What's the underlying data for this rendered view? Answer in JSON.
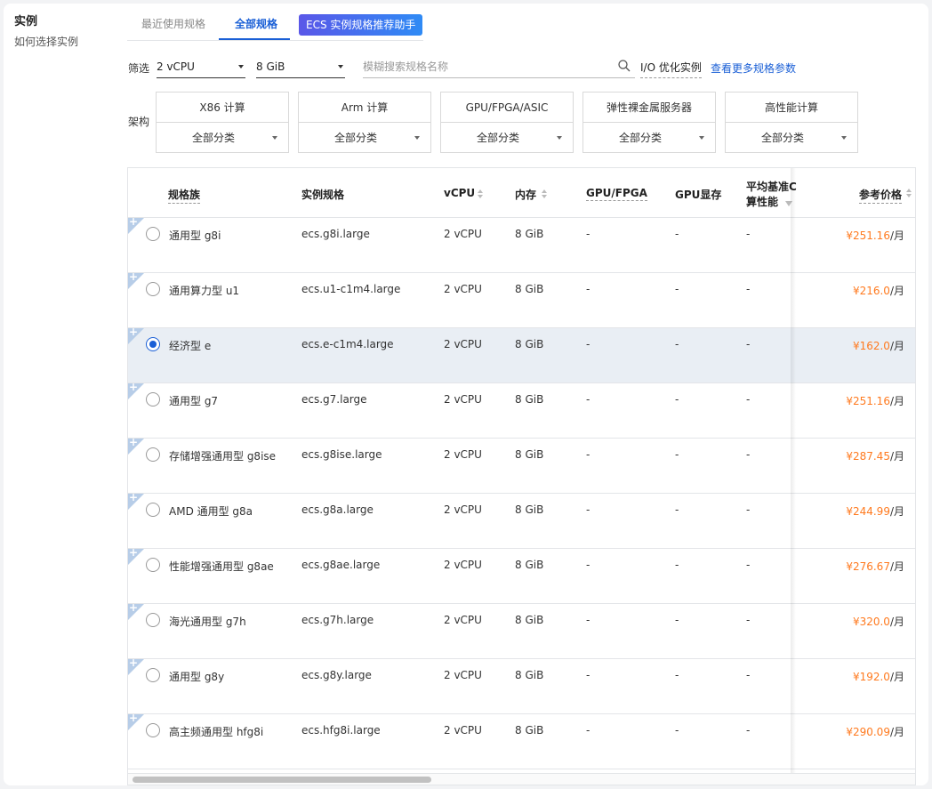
{
  "sidebar": {
    "title": "实例",
    "help": "如何选择实例"
  },
  "tabs": {
    "recent": "最近使用规格",
    "all": "全部规格",
    "assistant": "ECS 实例规格推荐助手"
  },
  "filter": {
    "label": "筛选",
    "vcpu": "2 vCPU",
    "memory": "8 GiB",
    "search_placeholder": "模糊搜索规格名称",
    "io_optimized": "I/O 优化实例",
    "more_params": "查看更多规格参数"
  },
  "arch": {
    "label": "架构",
    "items": [
      {
        "title": "X86 计算",
        "sub": "全部分类"
      },
      {
        "title": "Arm 计算",
        "sub": "全部分类"
      },
      {
        "title": "GPU/FPGA/ASIC",
        "sub": "全部分类"
      },
      {
        "title": "弹性裸金属服务器",
        "sub": "全部分类"
      },
      {
        "title": "高性能计算",
        "sub": "全部分类"
      }
    ]
  },
  "table": {
    "headers": {
      "family": "规格族",
      "spec": "实例规格",
      "vcpu": "vCPU",
      "memory": "内存",
      "gpu": "GPU/FPGA",
      "gpu_mem": "GPU显存",
      "baseline_1": "平均基准C",
      "baseline_2": "算性能",
      "price": "参考价格"
    },
    "rows": [
      {
        "family": "通用型 g8i",
        "spec": "ecs.g8i.large",
        "vcpu": "2 vCPU",
        "mem": "8 GiB",
        "gpu": "-",
        "gpumem": "-",
        "base": "-",
        "price": "¥251.16",
        "unit": "/月",
        "selected": false
      },
      {
        "family": "通用算力型 u1",
        "spec": "ecs.u1-c1m4.large",
        "vcpu": "2 vCPU",
        "mem": "8 GiB",
        "gpu": "-",
        "gpumem": "-",
        "base": "-",
        "price": "¥216.0",
        "unit": "/月",
        "selected": false
      },
      {
        "family": "经济型 e",
        "spec": "ecs.e-c1m4.large",
        "vcpu": "2 vCPU",
        "mem": "8 GiB",
        "gpu": "-",
        "gpumem": "-",
        "base": "-",
        "price": "¥162.0",
        "unit": "/月",
        "selected": true
      },
      {
        "family": "通用型 g7",
        "spec": "ecs.g7.large",
        "vcpu": "2 vCPU",
        "mem": "8 GiB",
        "gpu": "-",
        "gpumem": "-",
        "base": "-",
        "price": "¥251.16",
        "unit": "/月",
        "selected": false
      },
      {
        "family": "存储增强通用型 g8ise",
        "spec": "ecs.g8ise.large",
        "vcpu": "2 vCPU",
        "mem": "8 GiB",
        "gpu": "-",
        "gpumem": "-",
        "base": "-",
        "price": "¥287.45",
        "unit": "/月",
        "selected": false
      },
      {
        "family": "AMD 通用型 g8a",
        "spec": "ecs.g8a.large",
        "vcpu": "2 vCPU",
        "mem": "8 GiB",
        "gpu": "-",
        "gpumem": "-",
        "base": "-",
        "price": "¥244.99",
        "unit": "/月",
        "selected": false
      },
      {
        "family": "性能增强通用型 g8ae",
        "spec": "ecs.g8ae.large",
        "vcpu": "2 vCPU",
        "mem": "8 GiB",
        "gpu": "-",
        "gpumem": "-",
        "base": "-",
        "price": "¥276.67",
        "unit": "/月",
        "selected": false
      },
      {
        "family": "海光通用型 g7h",
        "spec": "ecs.g7h.large",
        "vcpu": "2 vCPU",
        "mem": "8 GiB",
        "gpu": "-",
        "gpumem": "-",
        "base": "-",
        "price": "¥320.0",
        "unit": "/月",
        "selected": false
      },
      {
        "family": "通用型 g8y",
        "spec": "ecs.g8y.large",
        "vcpu": "2 vCPU",
        "mem": "8 GiB",
        "gpu": "-",
        "gpumem": "-",
        "base": "-",
        "price": "¥192.0",
        "unit": "/月",
        "selected": false
      },
      {
        "family": "高主频通用型 hfg8i",
        "spec": "ecs.hfg8i.large",
        "vcpu": "2 vCPU",
        "mem": "8 GiB",
        "gpu": "-",
        "gpumem": "-",
        "base": "-",
        "price": "¥290.09",
        "unit": "/月",
        "selected": false
      }
    ]
  },
  "colors": {
    "accent": "#1a5fd6",
    "price": "#ff7a1f"
  },
  "icons": {
    "search": "search-icon",
    "sort": "sort-icon",
    "filter": "filter-icon",
    "caret": "chevron-down-icon"
  }
}
